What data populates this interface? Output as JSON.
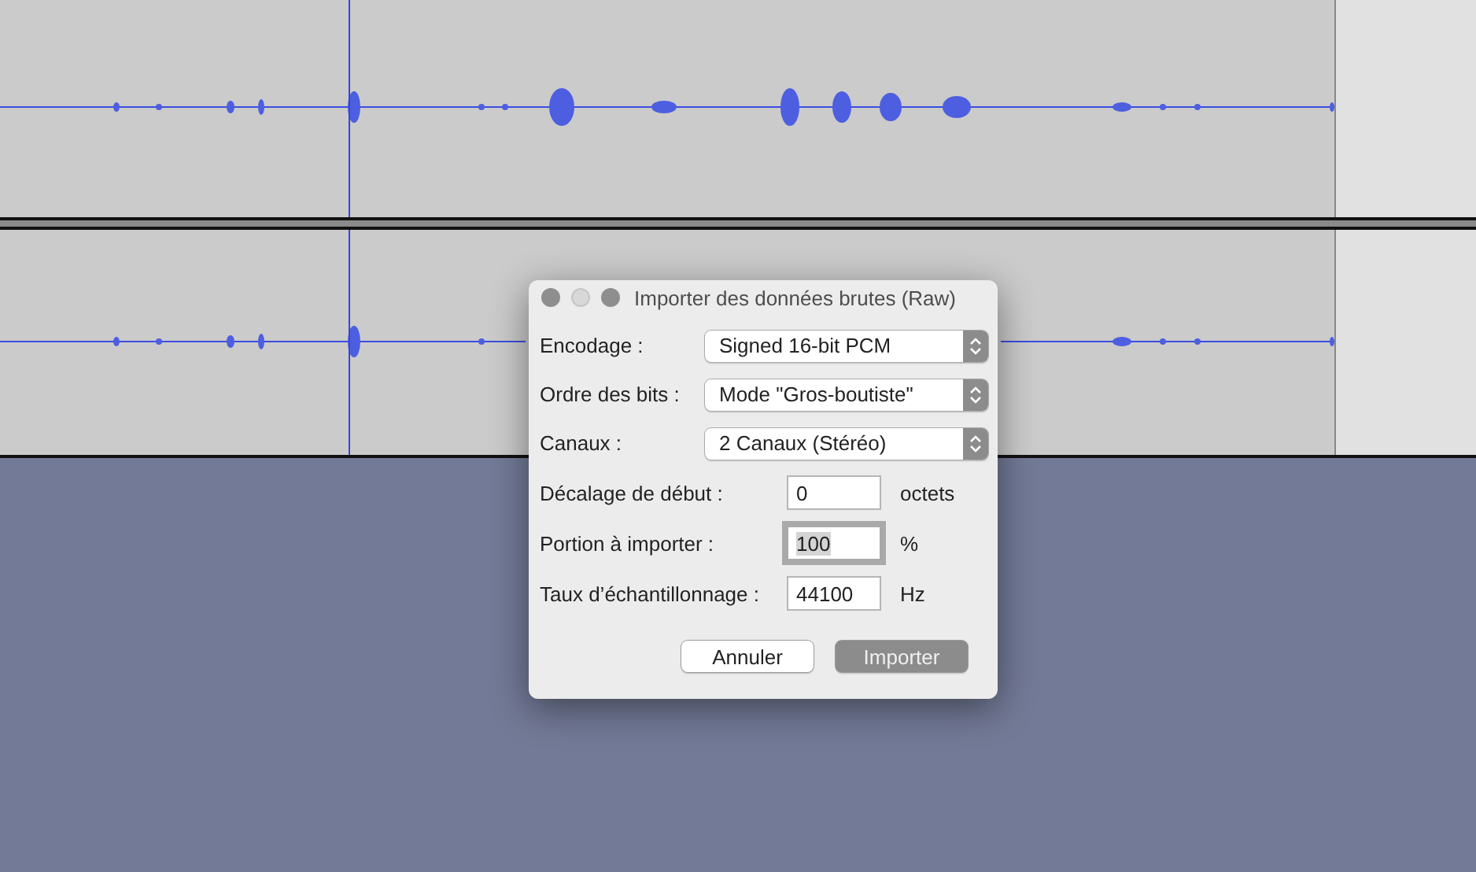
{
  "dialog": {
    "title": "Importer des données brutes (Raw)",
    "rows": [
      {
        "kind": "select",
        "label": "Encodage :",
        "value": "Signed 16-bit PCM"
      },
      {
        "kind": "select",
        "label": "Ordre des bits :",
        "value": "Mode \"Gros-boutiste\""
      },
      {
        "kind": "select",
        "label": "Canaux :",
        "value": "2 Canaux (Stéréo)"
      },
      {
        "kind": "input",
        "label": "Décalage de début :",
        "value": "0",
        "unit": "octets",
        "focused": false
      },
      {
        "kind": "input",
        "label": "Portion à importer :",
        "value": "100",
        "unit": "%",
        "focused": true
      },
      {
        "kind": "input",
        "label": "Taux d’échantillonnage :",
        "value": "44100",
        "unit": "Hz",
        "focused": false
      }
    ],
    "buttons": [
      {
        "label": "Annuler",
        "default": false
      },
      {
        "label": "Importer",
        "default": true
      }
    ]
  }
}
